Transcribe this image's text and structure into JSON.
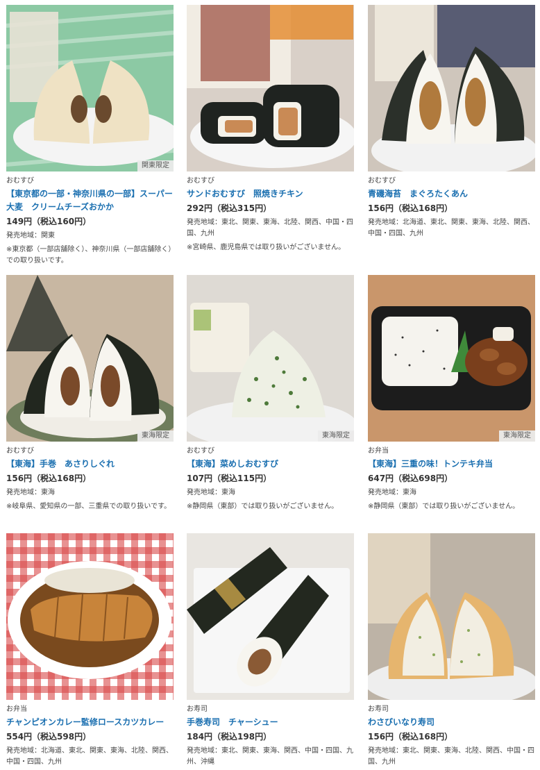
{
  "products": [
    {
      "category": "おむすび",
      "name": "【東京都の一部・神奈川県の一部】スーパー大麦　クリームチーズおかか",
      "price": "149円（税込160円）",
      "area": "発売地域：関東",
      "note": "※東京都（一部店舗除く）、神奈川県（一部店舗除く）での取り扱いです。",
      "badge": "関東限定",
      "image_icon": "barley-onigiri-image",
      "bg": "#8cc9a4",
      "plate": "#f4f4f4",
      "food": "#efe2c4",
      "accent": "#6a4a2e",
      "wrap": null
    },
    {
      "category": "おむすび",
      "name": "サンドおむすび　照焼きチキン",
      "price": "292円（税込315円）",
      "area": "発売地域：東北、関東、東海、北陸、関西、中国・四国、九州",
      "note": "※宮崎県、鹿児島県では取り扱いがございません。",
      "badge": "",
      "image_icon": "sandwich-onigiri-image",
      "bg": "#d9d0c8",
      "plate": "#f6f6f6",
      "food": "#f5f2ea",
      "accent": "#c98a55",
      "wrap": "#1f2320"
    },
    {
      "category": "おむすび",
      "name": "青磯海苔　まぐろたくあん",
      "price": "156円（税込168円）",
      "area": "発売地域：北海道、東北、関東、東海、北陸、関西、中国・四国、九州",
      "note": "",
      "badge": "",
      "image_icon": "tuna-onigiri-image",
      "bg": "#cfc6bc",
      "plate": "#f2f2f2",
      "food": "#f7f5ef",
      "accent": "#b07a3d",
      "wrap": "#2b302a"
    },
    {
      "category": "おむすび",
      "name": "【東海】手巻　あさりしぐれ",
      "price": "156円（税込168円）",
      "area": "発売地域：東海",
      "note": "※岐阜県、愛知県の一部、三重県での取り扱いです。",
      "badge": "東海限定",
      "image_icon": "clam-onigiri-image",
      "bg": "#c8b7a2",
      "plate": "#6f7d5c",
      "food": "#f7f5ef",
      "accent": "#7a4a2a",
      "wrap": "#22271f"
    },
    {
      "category": "おむすび",
      "name": "【東海】菜めしおむすび",
      "price": "107円（税込115円）",
      "area": "発売地域：東海",
      "note": "※静岡県（東部）では取り扱いがございません。",
      "badge": "東海限定",
      "image_icon": "greens-onigiri-image",
      "bg": "#dedad4",
      "plate": "#f2f2f2",
      "food": "#eef0e4",
      "accent": "#4e7a3a",
      "wrap": null
    },
    {
      "category": "お弁当",
      "name": "【東海】三重の味！トンテキ弁当",
      "price": "647円（税込698円）",
      "area": "発売地域：東海",
      "note": "※静岡県（東部）では取り扱いがございません。",
      "badge": "東海限定",
      "image_icon": "tonteki-bento-image",
      "bg": "#c9966b",
      "plate": "#1c1c1c",
      "food": "#f5f3ee",
      "accent": "#7a3f1c",
      "wrap": null
    },
    {
      "category": "お弁当",
      "name": "チャンピオンカレー監修ロースカツカレー",
      "price": "554円（税込598円）",
      "area": "発売地域：北海道、東北、関東、東海、北陸、関西、中国・四国、九州",
      "note": "",
      "badge": "",
      "image_icon": "katsu-curry-image",
      "bg": "#d94a4a",
      "plate": "#ffffff",
      "food": "#7a4a1e",
      "accent": "#c8843a",
      "wrap": null
    },
    {
      "category": "お寿司",
      "name": "手巻寿司　チャーシュー",
      "price": "184円（税込198円）",
      "area": "発売地域：東北、関東、東海、関西、中国・四国、九州、沖縄",
      "note": "",
      "badge": "",
      "image_icon": "temaki-sushi-image",
      "bg": "#e9e6e1",
      "plate": "#f7f7f7",
      "food": "#f7f5ef",
      "accent": "#8a5a35",
      "wrap": "#23281f"
    },
    {
      "category": "お寿司",
      "name": "わさびいなり寿司",
      "price": "156円（税込168円）",
      "area": "発売地域：東北、関東、東海、北陸、関西、中国・四国、九州",
      "note": "",
      "badge": "",
      "image_icon": "inari-sushi-image",
      "bg": "#bdb3a6",
      "plate": "#eeeeee",
      "food": "#e6b56e",
      "accent": "#f2eee2",
      "wrap": null
    }
  ]
}
